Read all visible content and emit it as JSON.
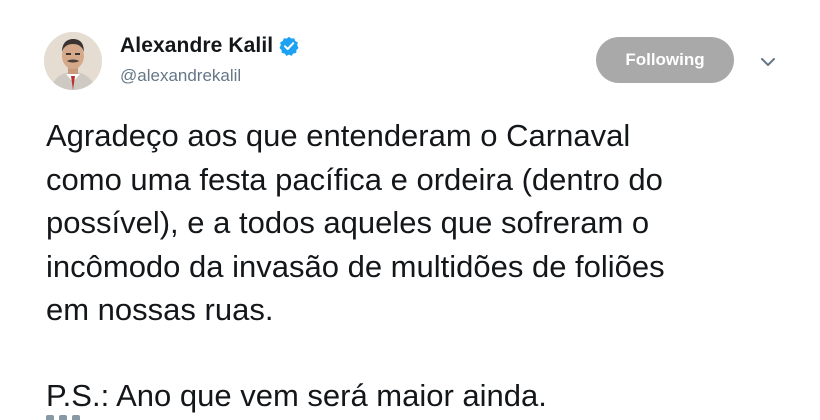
{
  "author": {
    "display_name": "Alexandre Kalil",
    "handle": "@alexandrekalil",
    "verified": true
  },
  "actions": {
    "follow_label": "Following",
    "caret_icon": "chevron-down-icon"
  },
  "tweet": {
    "paragraph_1": "Agradeço aos que entenderam o Carnaval\ncomo uma festa pacífica e ordeira (dentro do\npossível), e a todos aqueles que sofreram o\nincômodo da invasão de multidões de foliões\nem nossas ruas.",
    "paragraph_2": "P.S.: Ano que vem será maior ainda."
  },
  "colors": {
    "verified_badge": "#1da1f2",
    "follow_button_bg": "#a9a9a9",
    "text": "#14171a",
    "handle_text": "#657786"
  }
}
